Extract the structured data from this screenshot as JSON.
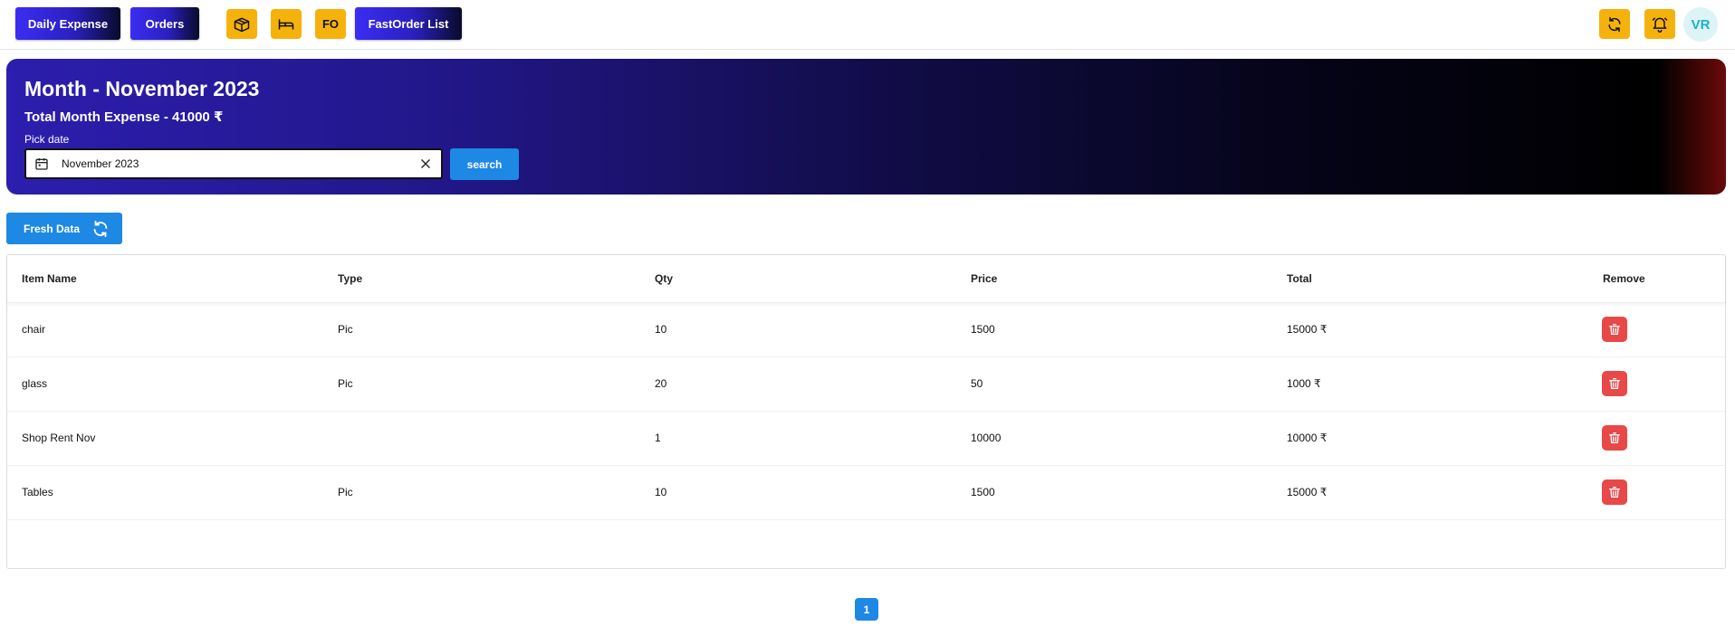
{
  "nav": {
    "daily_expense": "Daily Expense",
    "orders": "Orders",
    "fo": "FO",
    "fastorder_list": "FastOrder List",
    "box_icon": "package-icon",
    "bed_icon": "bed-icon",
    "refresh_icon": "refresh-icon",
    "bell_icon": "bell-icon",
    "avatar": "VR"
  },
  "banner": {
    "title": "Month - November 2023",
    "subtitle": "Total Month Expense - 41000 ₹",
    "pick_label": "Pick date",
    "date_value": "November 2023",
    "search_label": "search"
  },
  "fresh": {
    "label": "Fresh Data"
  },
  "table": {
    "headers": [
      "Item Name",
      "Type",
      "Qty",
      "Price",
      "Total",
      "Remove"
    ],
    "rows": [
      {
        "name": "chair",
        "type": "Pic",
        "qty": "10",
        "price": "1500",
        "total": "15000 ₹"
      },
      {
        "name": "glass",
        "type": "Pic",
        "qty": "20",
        "price": "50",
        "total": "1000 ₹"
      },
      {
        "name": "Shop Rent Nov",
        "type": "",
        "qty": "1",
        "price": "10000",
        "total": "10000 ₹"
      },
      {
        "name": "Tables",
        "type": "Pic",
        "qty": "10",
        "price": "1500",
        "total": "15000 ₹"
      }
    ]
  },
  "pagination": {
    "current": "1"
  },
  "colors": {
    "accent": "#1e88e5",
    "icon_button": "#f6b20c",
    "delete": "#e84848",
    "avatar_bg": "#ddf4f7",
    "avatar_text": "#1bb3c6"
  }
}
